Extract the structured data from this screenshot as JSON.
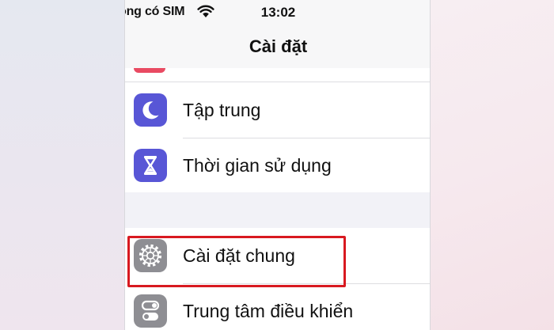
{
  "status_bar": {
    "carrier": "ông có SIM",
    "time": "13:02"
  },
  "nav": {
    "title": "Cài đặt"
  },
  "settings": {
    "focus": {
      "label": "Tập trung",
      "icon": "moon-icon",
      "color": "#5856d6"
    },
    "screen_time": {
      "label": "Thời gian sử dụng",
      "icon": "hourglass-icon",
      "color": "#5856d6"
    },
    "general": {
      "label": "Cài đặt chung",
      "icon": "gear-icon",
      "color": "#8e8e93"
    },
    "control_center": {
      "label": "Trung tâm điều khiển",
      "icon": "toggles-icon",
      "color": "#8e8e93"
    }
  },
  "colors": {
    "highlight": "#d81920",
    "cut_icon": "#e94a62"
  }
}
